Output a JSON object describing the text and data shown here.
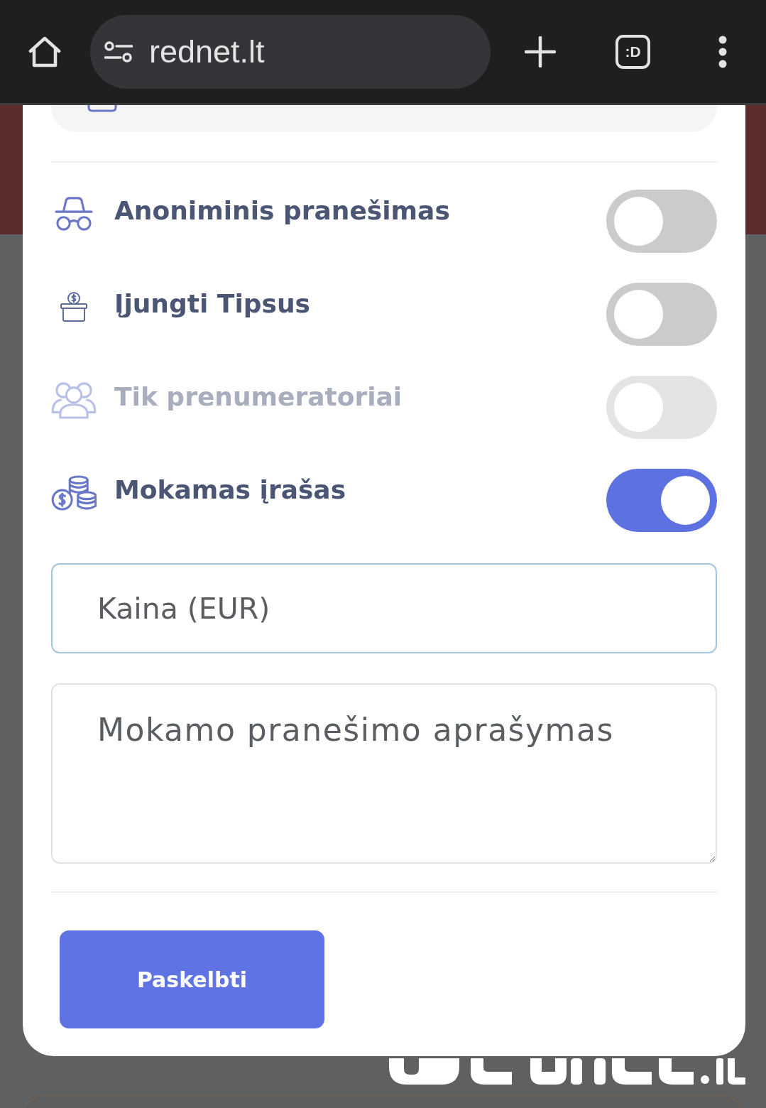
{
  "browser": {
    "url": "rednet.lt",
    "tab_count": ":D"
  },
  "form": {
    "toggles": [
      {
        "label": "Anoniminis pranešimas",
        "on": false,
        "disabled": false
      },
      {
        "label": "Įjungti Tipsus",
        "on": false,
        "disabled": false
      },
      {
        "label": "Tik prenumeratoriai",
        "on": false,
        "disabled": true
      },
      {
        "label": "Mokamas įrašas",
        "on": true,
        "disabled": false
      }
    ],
    "price_field": {
      "placeholder": "Kaina (EUR)"
    },
    "description_field": {
      "placeholder": "Mokamo pranešimo aprašymas"
    },
    "submit_button": {
      "label": "Paskelbti"
    }
  }
}
